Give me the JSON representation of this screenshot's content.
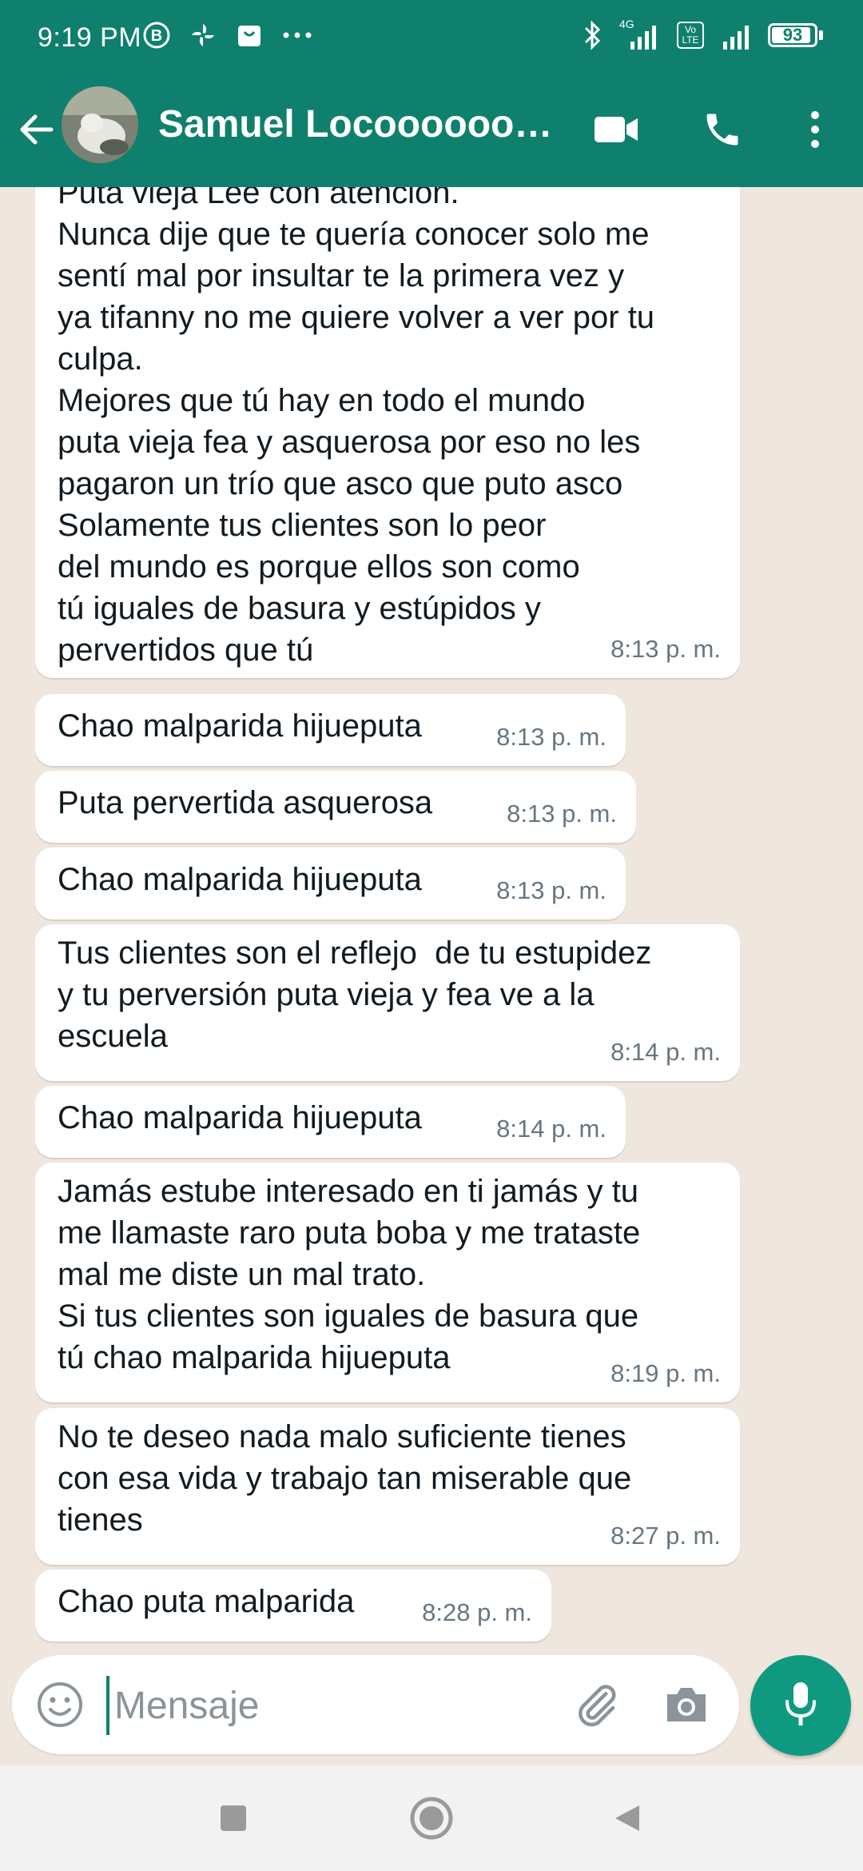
{
  "status_bar": {
    "time": "9:19 PM",
    "network_type": "4G",
    "volte_label": "Vo LTE",
    "battery_level": "93",
    "battery_fraction": 0.93,
    "icons": [
      "b-circle-icon",
      "pinwheel-icon",
      "shopping-bag-icon",
      "more-dots-icon",
      "bluetooth-icon",
      "signal-icon",
      "volte-icon",
      "signal-icon",
      "battery-icon"
    ]
  },
  "header": {
    "contact_name": "Samuel Locoooooooo...",
    "icons": [
      "back-arrow-icon",
      "avatar",
      "video-call-icon",
      "phone-icon",
      "more-vert-icon"
    ]
  },
  "messages": [
    {
      "text": "Puta vieja Lee con atención.\nNunca dije que te quería conocer solo me\nsentí mal por insultar te la primera vez y\nya tifanny no me quiere volver a ver por tu\nculpa.\nMejores que tú hay en todo el mundo\nputa vieja fea y asquerosa por eso no les\npagaron un trío que asco que puto asco\nSolamente tus clientes son lo peor\ndel mundo es porque ellos son como\ntú iguales de basura y estúpidos y\npervertidos que tú",
      "time": "8:13 p. m."
    },
    {
      "text": "Chao malparida hijueputa",
      "time": "8:13 p. m."
    },
    {
      "text": "Puta pervertida asquerosa",
      "time": "8:13 p. m."
    },
    {
      "text": "Chao malparida hijueputa",
      "time": "8:13 p. m."
    },
    {
      "text": "Tus clientes son el reflejo  de tu estupidez\ny tu perversión puta vieja y fea ve a la\nescuela",
      "time": "8:14 p. m."
    },
    {
      "text": "Chao malparida hijueputa",
      "time": "8:14 p. m."
    },
    {
      "text": "Jamás estube interesado en ti jamás y tu\nme llamaste raro puta boba y me trataste\nmal me diste un mal trato.\nSi tus clientes son iguales de basura que\ntú chao malparida hijueputa",
      "time": "8:19 p. m."
    },
    {
      "text": "No te deseo nada malo suficiente tienes\ncon esa vida y trabajo tan miserable que\ntienes",
      "time": "8:27 p. m."
    },
    {
      "text": "Chao puta malparida",
      "time": "8:28 p. m."
    }
  ],
  "input": {
    "placeholder": "Mensaje",
    "icons": [
      "emoji-icon",
      "attach-icon",
      "camera-icon",
      "mic-icon"
    ]
  },
  "nav_bar": {
    "icons": [
      "recents-square-icon",
      "home-circle-icon",
      "back-triangle-icon"
    ]
  },
  "colors": {
    "header_green": "#0f806d",
    "chat_background": "#efe7de",
    "bubble": "#ffffff",
    "timestamp": "#667781",
    "mic_button": "#0f9a80"
  }
}
